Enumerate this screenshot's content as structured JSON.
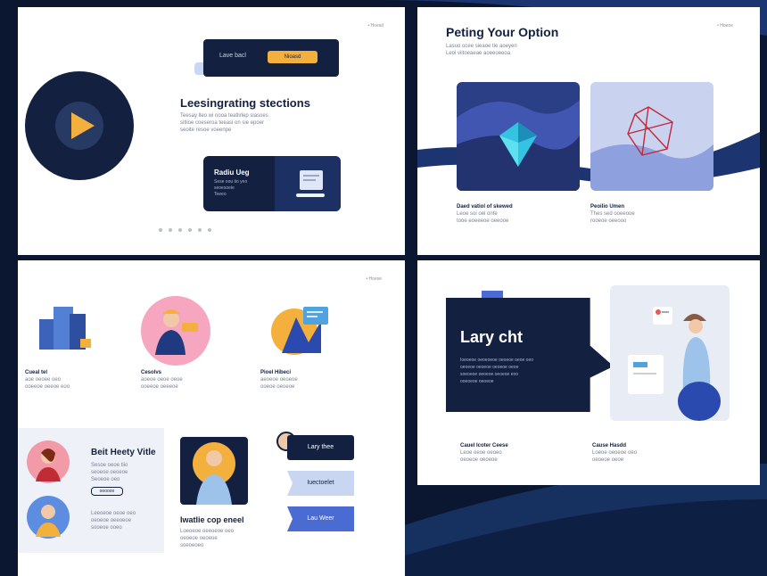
{
  "slides": {
    "s1": {
      "corner_label": "• Hoesd",
      "banner": {
        "text": "Lave bacl",
        "button": "Nioasd"
      },
      "heading": "Leesingrating stections",
      "body_lines": [
        "Teesay lleo wi nooa teatlirlep siasoes",
        "sitlioe coeseroa teeasi on sie epoer",
        "seoite resoe voeenpe"
      ],
      "card": {
        "title": "Radiu Ueg",
        "lines": [
          "Sese oou tio yeo",
          "seoesoeie",
          "Teeeo"
        ]
      },
      "pager_count": 6
    },
    "s2": {
      "corner_label": "• Hoeoe",
      "heading": "Peting Your Option",
      "sub_lines": [
        "Lasuo ocee sieaoe tie aoeyen",
        "Leoi viitoeaeae aoeeoeeoa"
      ],
      "items": [
        {
          "title": "Daed vatiol of skewed",
          "lines": [
            "Leoe soi oei onfe",
            "tooe eoeeeoe oeeooe"
          ]
        },
        {
          "title": "Peoilio Umen",
          "lines": [
            "Thes sed ooeeooe",
            "rooeoe oeeooo"
          ]
        }
      ]
    },
    "s3": {
      "corner_label": "• Hoese",
      "features": [
        {
          "title": "Cueal tel",
          "lines": [
            "aoe oeoee oeo",
            "ooeeoe oeeoe eoo"
          ]
        },
        {
          "title": "Cesolvs",
          "lines": [
            "aoeoe oeoe oeoe",
            "ooeeoe oeeeoe"
          ]
        },
        {
          "title": "Pioel Hibeci",
          "lines": [
            "aeoeoe oeoeoe",
            "ooeoe oeoeoe"
          ]
        }
      ],
      "profile_heading": "Beit Heety Vitle",
      "profile_lines": [
        "Sesoe oeoe tiio",
        "seoeoe oeoeoe",
        "Seoeoe oeo"
      ],
      "profile_link": "oooooo",
      "profile_lines_2": [
        "Leeoeoe oeoe oeo",
        "oeoeoe oeeoeoe",
        "sooeoe ooeo"
      ],
      "center_caption": "Iwatlie cop eneel",
      "center_lines": [
        "Loeoeoe oeeoeoe oeo",
        "oeoeoe oeoeoe",
        "soeoeoeo"
      ],
      "pill_buttons": [
        "Lary thee",
        "Iuectoelet",
        "Lau Weer"
      ]
    },
    "s4": {
      "corner_label": "",
      "heading": "Lary cht",
      "body_lines": [
        "Ioeoeoe oeoeoeoe oeoeoe oeoe oeo",
        "oeoeoe oeoeoe oeoeoe oeoe",
        "soeoeoe oeoeoe oeoeoe eoo",
        "ooeoeoe oeoeoe"
      ],
      "items": [
        {
          "title": "Cauel Icoter Ceese",
          "lines": [
            "Leoe oeoe oeoeo",
            "oeoeoe oeoeoe"
          ]
        },
        {
          "title": "Cause Hasdd",
          "lines": [
            "Loeoe oeoeoe oeo",
            "oeoeoe oeoe"
          ]
        }
      ]
    }
  },
  "colors": {
    "navy": "#13203f",
    "accent": "#f4b03c",
    "blue": "#4a6bd1",
    "pale_blue": "#c9d6f2"
  }
}
